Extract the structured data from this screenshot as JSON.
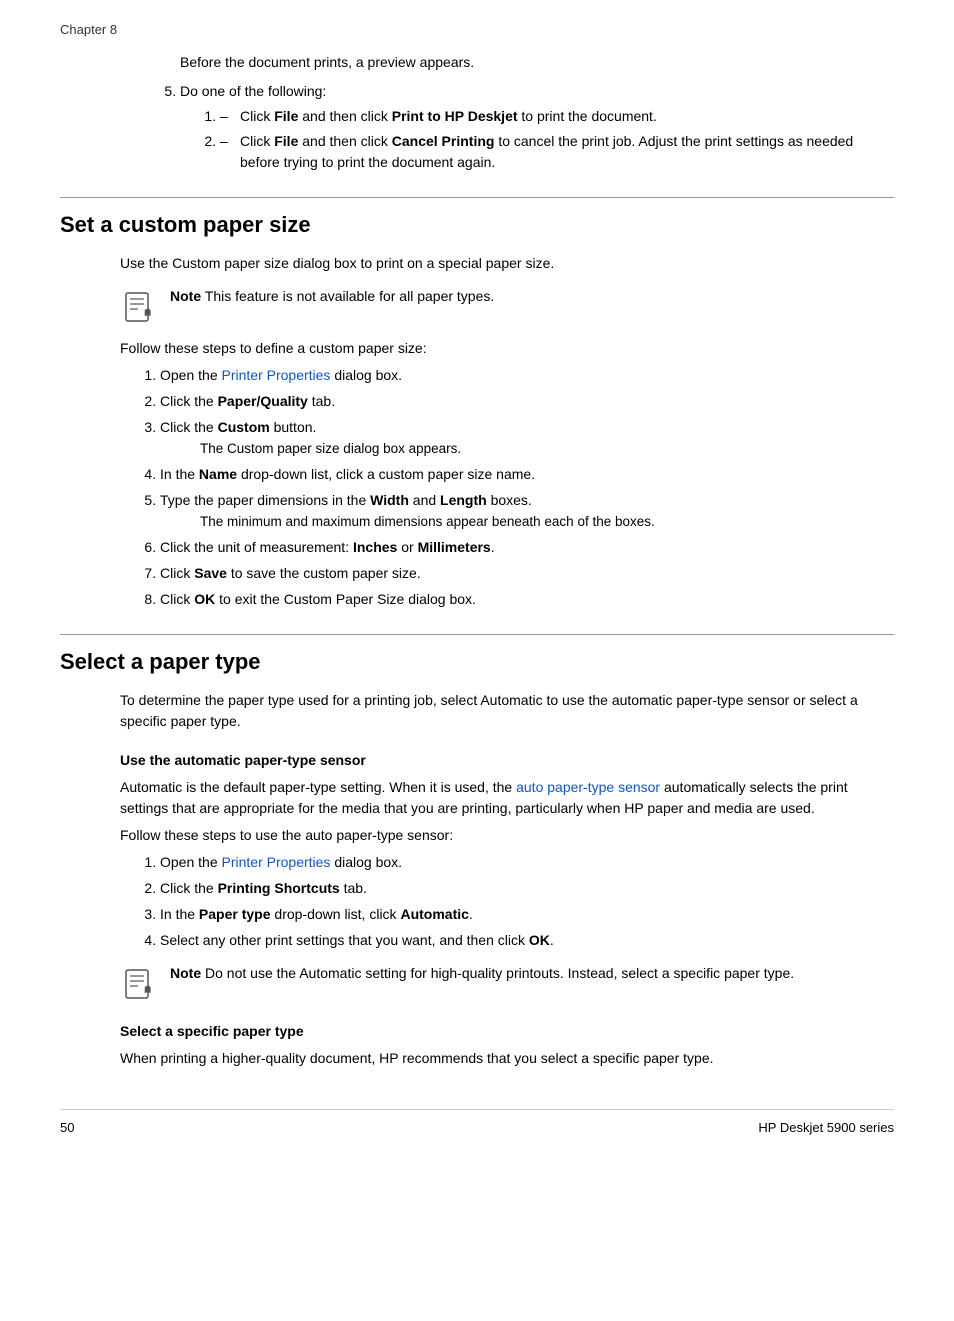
{
  "chapter": "Chapter 8",
  "intro": {
    "preview_text": "Before the document prints, a preview appears.",
    "step5_label": "Do one of the following:",
    "bullets": [
      {
        "text_before": "Click ",
        "bold1": "File",
        "text_mid": " and then click ",
        "bold2": "Print to HP Deskjet",
        "text_after": " to print the document."
      },
      {
        "text_before": "Click ",
        "bold1": "File",
        "text_mid": " and then click ",
        "bold2": "Cancel Printing",
        "text_after": " to cancel the print job. Adjust the print settings as needed before trying to print the document again."
      }
    ]
  },
  "section1": {
    "title": "Set a custom paper size",
    "intro": "Use the Custom paper size dialog box to print on a special paper size.",
    "note": "This feature is not available for all paper types.",
    "follow_text": "Follow these steps to define a custom paper size:",
    "steps": [
      {
        "id": 1,
        "text_before": "Open the ",
        "link": "Printer Properties",
        "text_after": " dialog box."
      },
      {
        "id": 2,
        "text_before": "Click the ",
        "bold": "Paper/Quality",
        "text_after": " tab."
      },
      {
        "id": 3,
        "text_before": "Click the ",
        "bold": "Custom",
        "text_after": " button.",
        "sub": "The Custom paper size dialog box appears."
      },
      {
        "id": 4,
        "text_before": "In the ",
        "bold": "Name",
        "text_after": " drop-down list, click a custom paper size name."
      },
      {
        "id": 5,
        "text_before": "Type the paper dimensions in the ",
        "bold1": "Width",
        "text_mid": " and ",
        "bold2": "Length",
        "text_after": " boxes.",
        "sub": "The minimum and maximum dimensions appear beneath each of the boxes."
      },
      {
        "id": 6,
        "text_before": "Click the unit of measurement: ",
        "bold1": "Inches",
        "text_mid": " or ",
        "bold2": "Millimeters",
        "text_after": "."
      },
      {
        "id": 7,
        "text_before": "Click ",
        "bold": "Save",
        "text_after": " to save the custom paper size."
      },
      {
        "id": 8,
        "text_before": "Click ",
        "bold": "OK",
        "text_after": " to exit the Custom Paper Size dialog box."
      }
    ]
  },
  "section2": {
    "title": "Select a paper type",
    "intro": "To determine the paper type used for a printing job, select Automatic to use the automatic paper-type sensor or select a specific paper type.",
    "subsection1": {
      "title": "Use the automatic paper-type sensor",
      "para1_before": "Automatic is the default paper-type setting. When it is used, the ",
      "link": "auto paper-type sensor",
      "para1_after": " automatically selects the print settings that are appropriate for the media that you are printing, particularly when HP paper and media are used.",
      "follow_text": "Follow these steps to use the auto paper-type sensor:",
      "steps": [
        {
          "id": 1,
          "text_before": "Open the ",
          "link": "Printer Properties",
          "text_after": " dialog box."
        },
        {
          "id": 2,
          "text_before": "Click the ",
          "bold": "Printing Shortcuts",
          "text_after": " tab."
        },
        {
          "id": 3,
          "text_before": "In the ",
          "bold1": "Paper type",
          "text_mid": " drop-down list, click ",
          "bold2": "Automatic",
          "text_after": "."
        },
        {
          "id": 4,
          "text_before": "Select any other print settings that you want, and then click ",
          "bold": "OK",
          "text_after": "."
        }
      ],
      "note": "Do not use the Automatic setting for high-quality printouts. Instead, select a specific paper type."
    },
    "subsection2": {
      "title": "Select a specific paper type",
      "para": "When printing a higher-quality document, HP recommends that you select a specific paper type."
    }
  },
  "footer": {
    "page_number": "50",
    "product_name": "HP Deskjet 5900 series"
  }
}
